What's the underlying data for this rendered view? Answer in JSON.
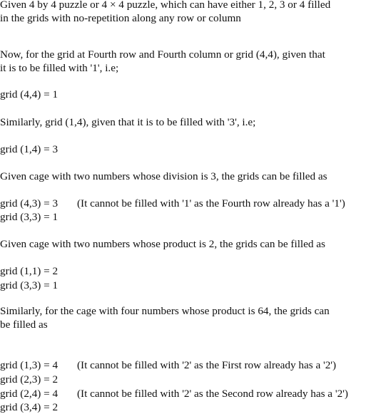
{
  "lines": [
    {
      "text": "Given 4 by 4 puzzle or 4 × 4 puzzle, which can have either 1, 2, 3 or 4 filled"
    },
    {
      "text": "in the grids with no-repetition along any row or column"
    },
    {
      "text": "Now, for the grid at Fourth row and Fourth column or grid (4,4), given that"
    },
    {
      "text": "it is to be filled with '1', i.e;"
    },
    {
      "text": "grid (4,4) = 1"
    },
    {
      "text": "Similarly, grid (1,4), given that it is to be filled with '3', i.e;"
    },
    {
      "text": "grid (1,4) = 3"
    },
    {
      "text": "Given cage with two numbers whose division is 3, the grids can be filled as"
    },
    {
      "text": "grid (4,3) = 3",
      "note": "(It cannot be filled with '1' as the Fourth row already has a '1')"
    },
    {
      "text": "grid (3,3) = 1"
    },
    {
      "text": "Given cage with two numbers whose product is 2, the grids can be filled as"
    },
    {
      "text": "grid (1,1) = 2"
    },
    {
      "text": "grid (3,3) = 1"
    },
    {
      "text": "Similarly, for the cage with four numbers whose product is 64, the grids can"
    },
    {
      "text": "be filled as"
    },
    {
      "text": "grid (1,3) = 4",
      "note": "(It cannot be filled with '2' as the First row already has a '2')"
    },
    {
      "text": "grid (2,3) = 2"
    },
    {
      "text": "grid (2,4) = 4",
      "note": "(It cannot be filled with '2' as the Second row already has a '2')"
    },
    {
      "text": "grid (3,4) = 2"
    }
  ]
}
